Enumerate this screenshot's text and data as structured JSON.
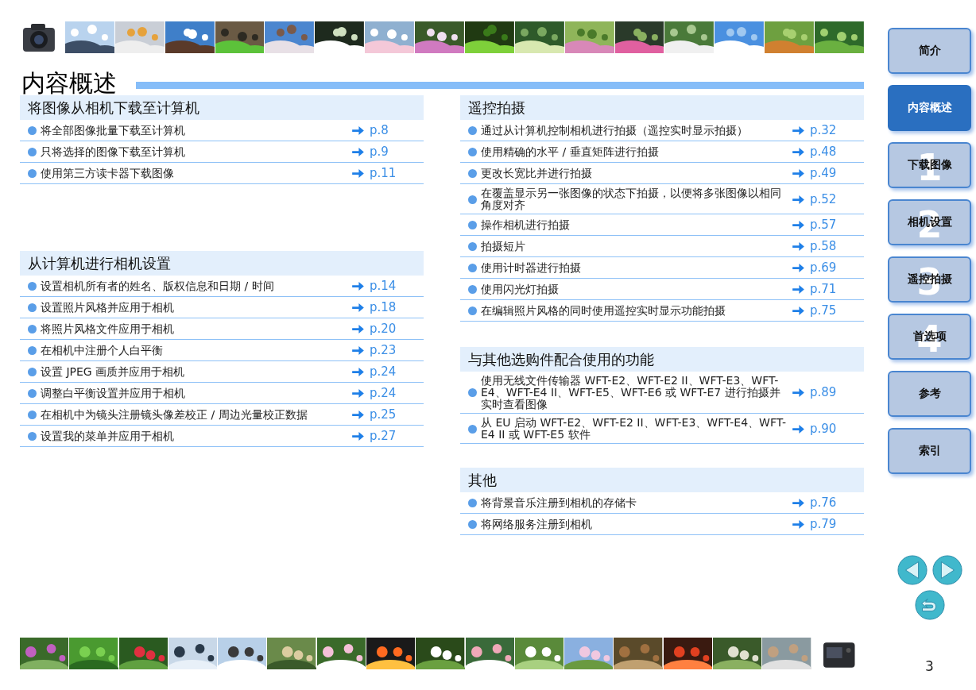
{
  "title": "内容概述",
  "left_sections": [
    {
      "heading": "将图像从相机下载至计算机",
      "items": [
        {
          "text": "将全部图像批量下载至计算机",
          "page": "p.8"
        },
        {
          "text": "只将选择的图像下载至计算机",
          "page": "p.9"
        },
        {
          "text": "使用第三方读卡器下载图像",
          "page": "p.11"
        }
      ]
    },
    {
      "heading": "从计算机进行相机设置",
      "items": [
        {
          "text": "设置相机所有者的姓名、版权信息和日期 / 时间",
          "page": "p.14"
        },
        {
          "text": "设置照片风格并应用于相机",
          "page": "p.18"
        },
        {
          "text": "将照片风格文件应用于相机",
          "page": "p.20"
        },
        {
          "text": "在相机中注册个人白平衡",
          "page": "p.23"
        },
        {
          "text": "设置 JPEG 画质并应用于相机",
          "page": "p.24"
        },
        {
          "text": "调整白平衡设置并应用于相机",
          "page": "p.24"
        },
        {
          "text": "在相机中为镜头注册镜头像差校正 / 周边光量校正数据",
          "page": "p.25"
        },
        {
          "text": "设置我的菜单并应用于相机",
          "page": "p.27"
        }
      ]
    }
  ],
  "right_sections": [
    {
      "heading": "遥控拍摄",
      "items": [
        {
          "text": "通过从计算机控制相机进行拍摄（遥控实时显示拍摄）",
          "page": "p.32"
        },
        {
          "text": "使用精确的水平 / 垂直矩阵进行拍摄",
          "page": "p.48"
        },
        {
          "text": "更改长宽比并进行拍摄",
          "page": "p.49"
        },
        {
          "text": "在覆盖显示另一张图像的状态下拍摄，以便将多张图像以相同角度对齐",
          "page": "p.52"
        },
        {
          "text": "操作相机进行拍摄",
          "page": "p.57"
        },
        {
          "text": "拍摄短片",
          "page": "p.58"
        },
        {
          "text": "使用计时器进行拍摄",
          "page": "p.69"
        },
        {
          "text": "使用闪光灯拍摄",
          "page": "p.71"
        },
        {
          "text": "在编辑照片风格的同时使用遥控实时显示功能拍摄",
          "page": "p.75"
        }
      ]
    },
    {
      "heading": "与其他选购件配合使用的功能",
      "items": [
        {
          "text": "使用无线文件传输器 WFT-E2、WFT-E2 II、WFT-E3、WFT-E4、WFT-E4 II、WFT-E5、WFT-E6 或 WFT-E7 进行拍摄并实时查看图像",
          "page": "p.89"
        },
        {
          "text": "从 EU 启动 WFT-E2、WFT-E2 II、WFT-E3、WFT-E4、WFT-E4 II 或 WFT-E5 软件",
          "page": "p.90"
        }
      ]
    },
    {
      "heading": "其他",
      "items": [
        {
          "text": "将背景音乐注册到相机的存储卡",
          "page": "p.76"
        },
        {
          "text": "将网络服务注册到相机",
          "page": "p.79"
        }
      ]
    }
  ],
  "nav": [
    {
      "label": "简介",
      "selected": false
    },
    {
      "label": "内容概述",
      "selected": true
    },
    {
      "label": "下载图像",
      "number": "1",
      "selected": false
    },
    {
      "label": "相机设置",
      "number": "2",
      "selected": false
    },
    {
      "label": "遥控拍摄",
      "number": "3",
      "selected": false
    },
    {
      "label": "首选项",
      "number": "4",
      "selected": false
    },
    {
      "label": "参考",
      "selected": false
    },
    {
      "label": "索引",
      "selected": false
    }
  ],
  "page_number": "3"
}
